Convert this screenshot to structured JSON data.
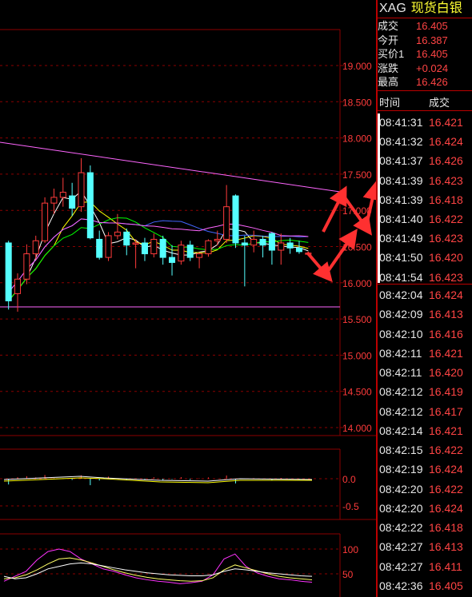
{
  "header": {
    "code": "XAG",
    "name": "现货白银"
  },
  "quote": [
    {
      "label": "成交",
      "value": "16.405"
    },
    {
      "label": "今开",
      "value": "16.387"
    },
    {
      "label": "买价1",
      "value": "16.405"
    },
    {
      "label": "涨跌",
      "value": "+0.024"
    },
    {
      "label": "最高",
      "value": "16.426"
    }
  ],
  "ticks_header": {
    "time": "时间",
    "price": "成交"
  },
  "ticks": [
    {
      "time": "08:41:31",
      "price": "16.421"
    },
    {
      "time": "08:41:32",
      "price": "16.424"
    },
    {
      "time": "08:41:37",
      "price": "16.426"
    },
    {
      "time": "08:41:39",
      "price": "16.423"
    },
    {
      "time": "08:41:39",
      "price": "16.418"
    },
    {
      "time": "08:41:40",
      "price": "16.422"
    },
    {
      "time": "08:41:49",
      "price": "16.423"
    },
    {
      "time": "08:41:50",
      "price": "16.420"
    },
    {
      "time": "08:41:54",
      "price": "16.423"
    },
    {
      "time": "08:42:04",
      "price": "16.424"
    },
    {
      "time": "08:42:09",
      "price": "16.413"
    },
    {
      "time": "08:42:10",
      "price": "16.416"
    },
    {
      "time": "08:42:11",
      "price": "16.421"
    },
    {
      "time": "08:42:11",
      "price": "16.420"
    },
    {
      "time": "08:42:12",
      "price": "16.419"
    },
    {
      "time": "08:42:12",
      "price": "16.417"
    },
    {
      "time": "08:42:14",
      "price": "16.421"
    },
    {
      "time": "08:42:15",
      "price": "16.422"
    },
    {
      "time": "08:42:19",
      "price": "16.424"
    },
    {
      "time": "08:42:20",
      "price": "16.422"
    },
    {
      "time": "08:42:20",
      "price": "16.424"
    },
    {
      "time": "08:42:22",
      "price": "16.418"
    },
    {
      "time": "08:42:27",
      "price": "16.413"
    },
    {
      "time": "08:42:27",
      "price": "16.411"
    },
    {
      "time": "08:42:36",
      "price": "16.405"
    }
  ],
  "colors": {
    "up": "#ff3b3b",
    "down": "#55ffff",
    "grid": "#8b0000",
    "axis_text": "#ff3b3b",
    "trend": "#ff66ff",
    "arrow": "#ff3030"
  },
  "chart_data": {
    "type": "candlestick",
    "y_ticks": [
      "19.000",
      "18.500",
      "18.000",
      "17.500",
      "17.000",
      "16.500",
      "16.000",
      "15.500",
      "15.000",
      "14.500",
      "14.000"
    ],
    "ylim": [
      14.0,
      19.0
    ],
    "candles": [
      {
        "o": 16.55,
        "h": 16.58,
        "l": 15.63,
        "c": 15.75
      },
      {
        "o": 15.85,
        "h": 16.13,
        "l": 15.6,
        "c": 16.05
      },
      {
        "o": 16.05,
        "h": 16.53,
        "l": 15.98,
        "c": 16.4
      },
      {
        "o": 16.4,
        "h": 16.65,
        "l": 16.32,
        "c": 16.58
      },
      {
        "o": 16.58,
        "h": 17.18,
        "l": 16.55,
        "c": 17.1
      },
      {
        "o": 17.1,
        "h": 17.3,
        "l": 16.95,
        "c": 17.18
      },
      {
        "o": 17.18,
        "h": 17.45,
        "l": 17.05,
        "c": 17.25
      },
      {
        "o": 17.2,
        "h": 17.38,
        "l": 16.92,
        "c": 17.03
      },
      {
        "o": 17.05,
        "h": 17.72,
        "l": 16.98,
        "c": 17.52
      },
      {
        "o": 17.52,
        "h": 17.62,
        "l": 16.6,
        "c": 16.62
      },
      {
        "o": 16.6,
        "h": 16.72,
        "l": 16.32,
        "c": 16.35
      },
      {
        "o": 16.35,
        "h": 16.7,
        "l": 16.3,
        "c": 16.65
      },
      {
        "o": 16.65,
        "h": 16.95,
        "l": 16.6,
        "c": 16.7
      },
      {
        "o": 16.7,
        "h": 16.75,
        "l": 16.38,
        "c": 16.52
      },
      {
        "o": 16.55,
        "h": 16.6,
        "l": 16.2,
        "c": 16.55
      },
      {
        "o": 16.55,
        "h": 16.62,
        "l": 16.3,
        "c": 16.4
      },
      {
        "o": 16.4,
        "h": 16.68,
        "l": 16.35,
        "c": 16.6
      },
      {
        "o": 16.6,
        "h": 16.65,
        "l": 16.25,
        "c": 16.35
      },
      {
        "o": 16.35,
        "h": 16.52,
        "l": 16.1,
        "c": 16.28
      },
      {
        "o": 16.3,
        "h": 16.58,
        "l": 16.25,
        "c": 16.52
      },
      {
        "o": 16.52,
        "h": 16.58,
        "l": 16.3,
        "c": 16.35
      },
      {
        "o": 16.35,
        "h": 16.42,
        "l": 16.2,
        "c": 16.4
      },
      {
        "o": 16.4,
        "h": 16.6,
        "l": 16.36,
        "c": 16.58
      },
      {
        "o": 16.58,
        "h": 16.72,
        "l": 16.52,
        "c": 16.6
      },
      {
        "o": 16.6,
        "h": 17.35,
        "l": 16.55,
        "c": 17.05
      },
      {
        "o": 17.2,
        "h": 17.22,
        "l": 16.48,
        "c": 16.55
      },
      {
        "o": 16.55,
        "h": 16.65,
        "l": 15.95,
        "c": 16.52
      },
      {
        "o": 16.52,
        "h": 16.72,
        "l": 16.42,
        "c": 16.6
      },
      {
        "o": 16.6,
        "h": 16.65,
        "l": 16.35,
        "c": 16.52
      },
      {
        "o": 16.68,
        "h": 16.7,
        "l": 16.25,
        "c": 16.45
      },
      {
        "o": 16.45,
        "h": 16.68,
        "l": 16.25,
        "c": 16.55
      },
      {
        "o": 16.55,
        "h": 16.62,
        "l": 16.4,
        "c": 16.48
      },
      {
        "o": 16.48,
        "h": 16.58,
        "l": 16.4,
        "c": 16.43
      },
      {
        "o": 16.41,
        "h": 16.43,
        "l": 16.38,
        "c": 16.41
      }
    ],
    "macd_ticks": [
      "0.0",
      "-0.5"
    ],
    "kdj_ticks": [
      "100",
      "50"
    ],
    "kdj": {
      "K": [
        35,
        45,
        55,
        78,
        95,
        100,
        95,
        80,
        70,
        60,
        55,
        48,
        42,
        38,
        35,
        33,
        30,
        32,
        35,
        48,
        80,
        90,
        65,
        52,
        45,
        40,
        38,
        35,
        33
      ],
      "D": [
        40,
        42,
        48,
        58,
        70,
        80,
        82,
        78,
        72,
        65,
        58,
        52,
        47,
        43,
        40,
        38,
        36,
        35,
        36,
        42,
        58,
        68,
        62,
        56,
        50,
        45,
        42,
        40,
        38
      ],
      "J": [
        45,
        40,
        42,
        50,
        60,
        65,
        70,
        72,
        70,
        66,
        62,
        58,
        55,
        52,
        50,
        48,
        47,
        46,
        46,
        48,
        55,
        60,
        58,
        55,
        52,
        50,
        48,
        46,
        45
      ]
    }
  }
}
